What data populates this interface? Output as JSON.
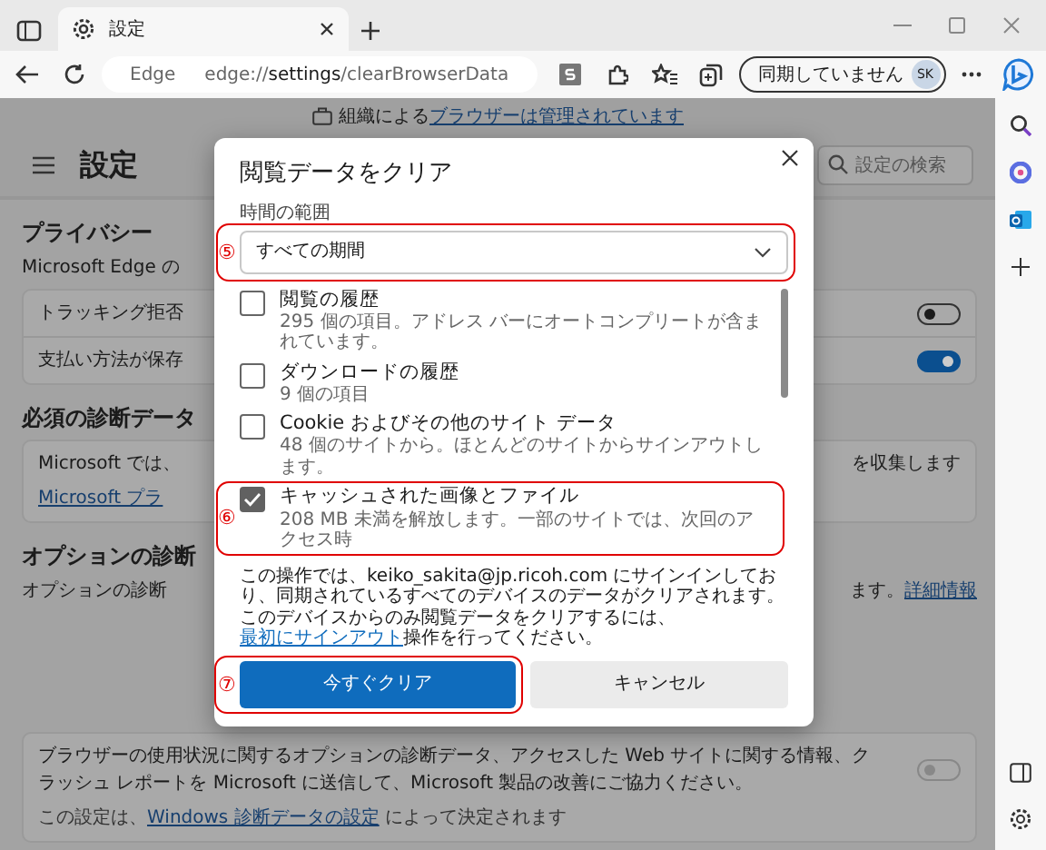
{
  "browser": {
    "tab_title": "設定",
    "site_label": "Edge",
    "url": "edge://**settings**/clearBrowserData",
    "sync_button": "同期していません",
    "avatar": "SK"
  },
  "banner": {
    "text": "組織による",
    "link": "ブラウザーは管理されています"
  },
  "header": {
    "title": "設定",
    "search_placeholder": "設定の検索"
  },
  "blocks": [
    {
      "kind": "heading",
      "text": "プライバシー"
    },
    {
      "kind": "text",
      "left": "Microsoft Edge の"
    },
    {
      "kind": "card",
      "rows": [
        {
          "left": "トラッキング拒否",
          "on": false
        },
        {
          "left": "支払い方法が保存",
          "on": true
        }
      ]
    },
    {
      "kind": "heading",
      "text": "必須の診断データ"
    },
    {
      "kind": "card",
      "rows": [
        {
          "left": "Microsoft では、",
          "right": "を収集します",
          "link": "Microsoft プラ"
        }
      ]
    },
    {
      "kind": "heading",
      "text": "オプションの診断"
    },
    {
      "kind": "text",
      "left": "オプションの診断",
      "right": "ます。",
      "right_link": "詳細情報"
    },
    {
      "kind": "card",
      "rows": [
        {
          "text": "ブラウザーの使用状況に関するオプションの診断データ、アクセスした Web サイトに関する情報、クラッシュ レポートを Microsoft に送信して、Microsoft 製品の改善にご協力ください。",
          "on": false,
          "disabled": true,
          "note_before": "この設定は、",
          "note_link": "Windows 診断データの設定",
          "note_after": " によって決定されます"
        }
      ]
    }
  ],
  "dialog": {
    "title": "閲覧データをクリア",
    "range_label": "時間の範囲",
    "range_value": "すべての期間",
    "range_annotation": "⑤",
    "items": [
      {
        "title": "閲覧の履歴",
        "description": "295 個の項目。アドレス バーにオートコンプリートが含まれています。",
        "checked": false
      },
      {
        "title": "ダウンロードの履歴",
        "description": "9 個の項目",
        "checked": false
      },
      {
        "title": "Cookie およびその他のサイト データ",
        "description": "48 個のサイトから。ほとんどのサイトからサインアウトします。",
        "checked": false
      },
      {
        "title": "キャッシュされた画像とファイル",
        "description": "208 MB 未満を解放します。一部のサイトでは、次回のアクセス時",
        "checked": true,
        "annotation": "⑥"
      }
    ],
    "notice_before": "この操作では、keiko_sakita@jp.ricoh.com にサインインしており、同期されているすべてのデバイスのデータがクリアされます。このデバイスからのみ閲覧データをクリアするには、",
    "notice_link": "最初にサインアウト",
    "notice_after": "操作を行ってください。",
    "buttons": [
      {
        "label": "今すぐクリア",
        "kind": "primary",
        "annotation": "⑦"
      },
      {
        "label": "キャンセル",
        "kind": "secondary"
      }
    ]
  }
}
